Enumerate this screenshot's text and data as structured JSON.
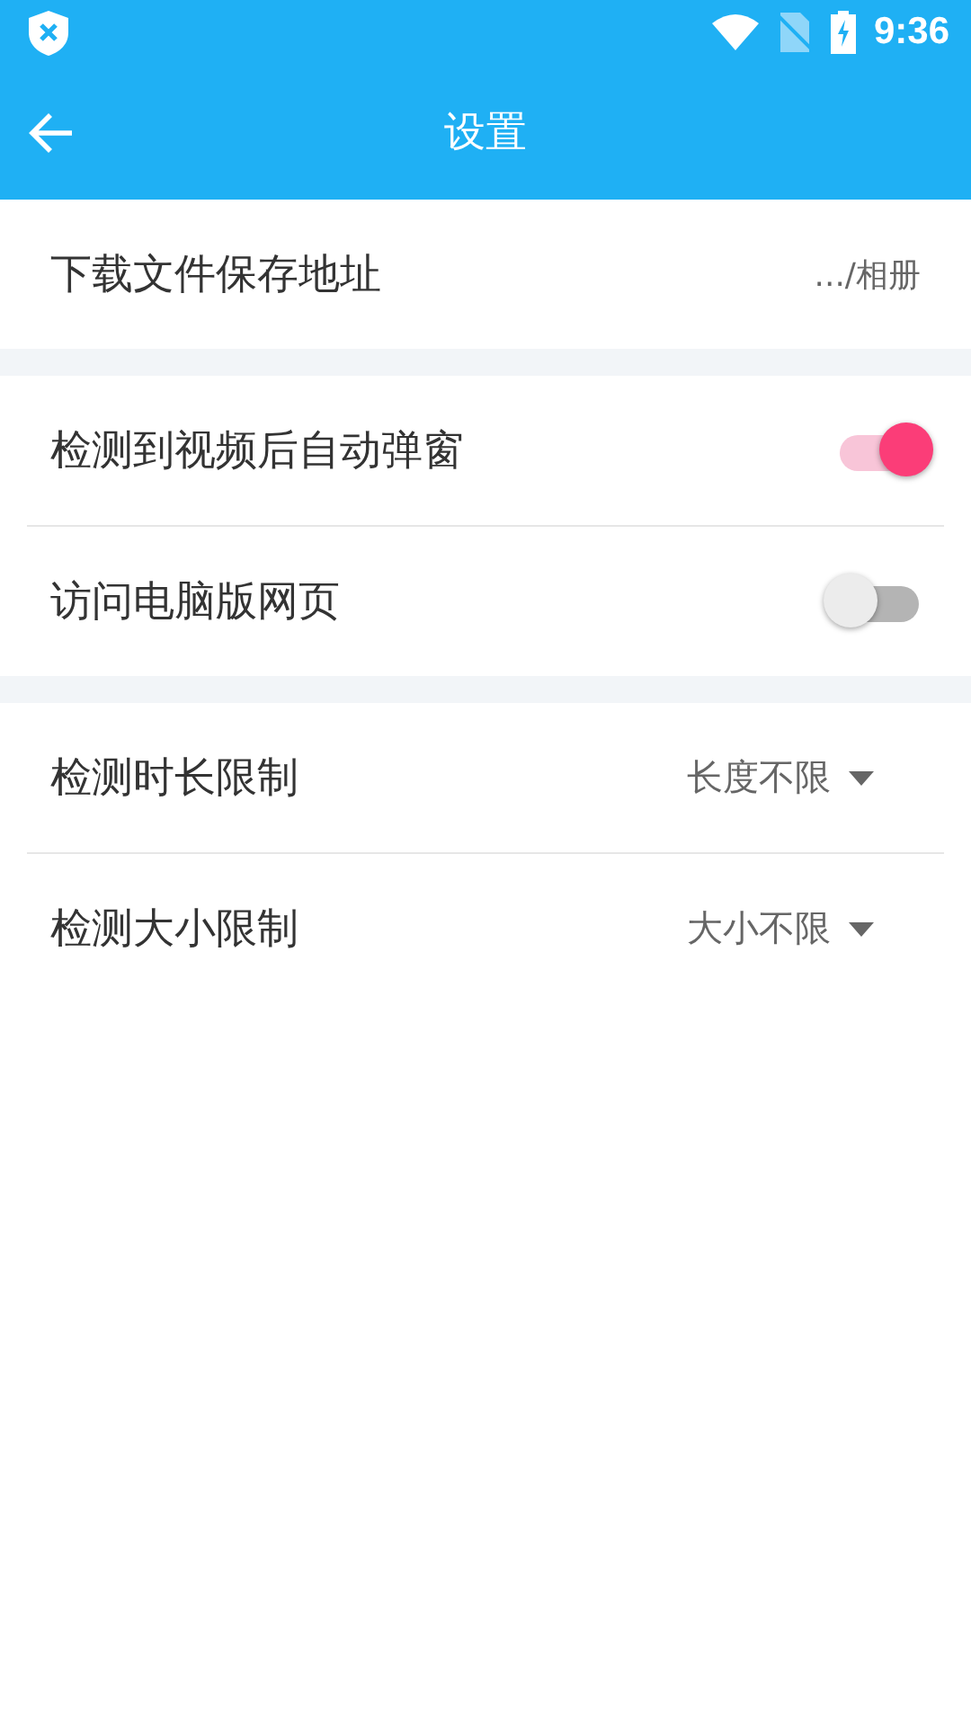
{
  "status_bar": {
    "time": "9:36"
  },
  "toolbar": {
    "title": "设置"
  },
  "sections": [
    {
      "rows": [
        {
          "kind": "value",
          "label": "下载文件保存地址",
          "value": ".../相册"
        }
      ]
    },
    {
      "rows": [
        {
          "kind": "toggle",
          "label": "检测到视频后自动弹窗",
          "on": true
        },
        {
          "kind": "toggle",
          "label": "访问电脑版网页",
          "on": false
        }
      ]
    },
    {
      "rows": [
        {
          "kind": "dropdown",
          "label": "检测时长限制",
          "value": "长度不限"
        },
        {
          "kind": "dropdown",
          "label": "检测大小限制",
          "value": "大小不限"
        }
      ]
    }
  ]
}
